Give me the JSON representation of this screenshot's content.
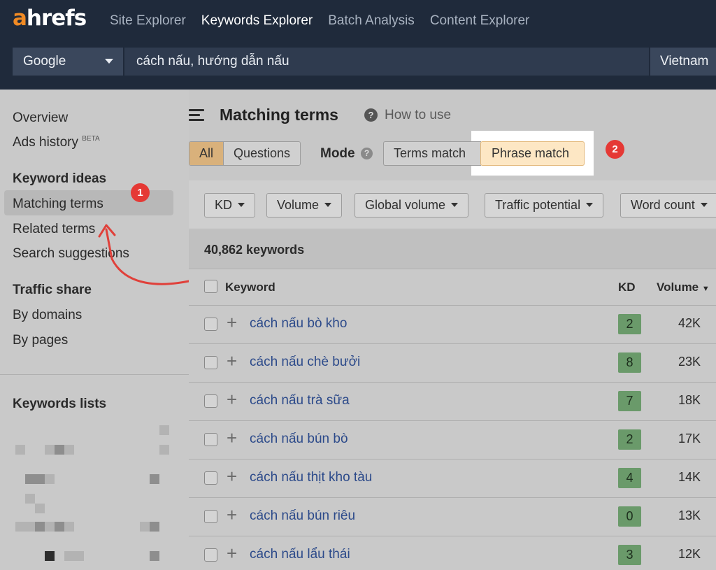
{
  "logo": {
    "accent": "a",
    "rest": "hrefs"
  },
  "nav": {
    "items": [
      "Site Explorer",
      "Keywords Explorer",
      "Batch Analysis",
      "Content Explorer"
    ],
    "active": "Keywords Explorer"
  },
  "search": {
    "engine": "Google",
    "query": "cách nấu, hướng dẫn nấu",
    "country": "Vietnam"
  },
  "sidebar": {
    "overview": "Overview",
    "ads_history": "Ads history",
    "ads_history_badge": "BETA",
    "keyword_ideas_heading": "Keyword ideas",
    "matching_terms": "Matching terms",
    "related_terms": "Related terms",
    "search_suggestions": "Search suggestions",
    "traffic_share_heading": "Traffic share",
    "by_domains": "By domains",
    "by_pages": "By pages",
    "keywords_lists_heading": "Keywords lists"
  },
  "annotations": {
    "badge1": "1",
    "badge2": "2"
  },
  "main": {
    "title": "Matching terms",
    "help_icon_glyph": "?",
    "how_to_use": "How to use",
    "tabs": {
      "all": "All",
      "questions": "Questions"
    },
    "mode_label": "Mode",
    "mode_terms": "Terms match",
    "mode_phrase": "Phrase match"
  },
  "filters": [
    "KD",
    "Volume",
    "Global volume",
    "Traffic potential",
    "Word count"
  ],
  "keyword_count": "40,862 keywords",
  "table": {
    "headers": {
      "keyword": "Keyword",
      "kd": "KD",
      "volume": "Volume"
    },
    "rows": [
      {
        "keyword": "cách nấu bò kho",
        "kd": "2",
        "volume": "42K"
      },
      {
        "keyword": "cách nấu chè bưởi",
        "kd": "8",
        "volume": "23K"
      },
      {
        "keyword": "cách nấu trà sữa",
        "kd": "7",
        "volume": "18K"
      },
      {
        "keyword": "cách nấu bún bò",
        "kd": "2",
        "volume": "17K"
      },
      {
        "keyword": "cách nấu thịt kho tàu",
        "kd": "4",
        "volume": "14K"
      },
      {
        "keyword": "cách nấu bún riêu",
        "kd": "0",
        "volume": "13K"
      },
      {
        "keyword": "cách nấu lẩu thái",
        "kd": "3",
        "volume": "12K"
      }
    ]
  },
  "colors": {
    "nav_bg": "#1f2a3b",
    "logo_accent": "#f08a24",
    "badge_red": "#e53935",
    "selected_tab": "#d9b17b",
    "phrase_match_bg": "#fde7c4",
    "kd_green": "#6a9a6a",
    "keyword_link": "#2c4a8a",
    "arrow_red": "#e0403a"
  }
}
